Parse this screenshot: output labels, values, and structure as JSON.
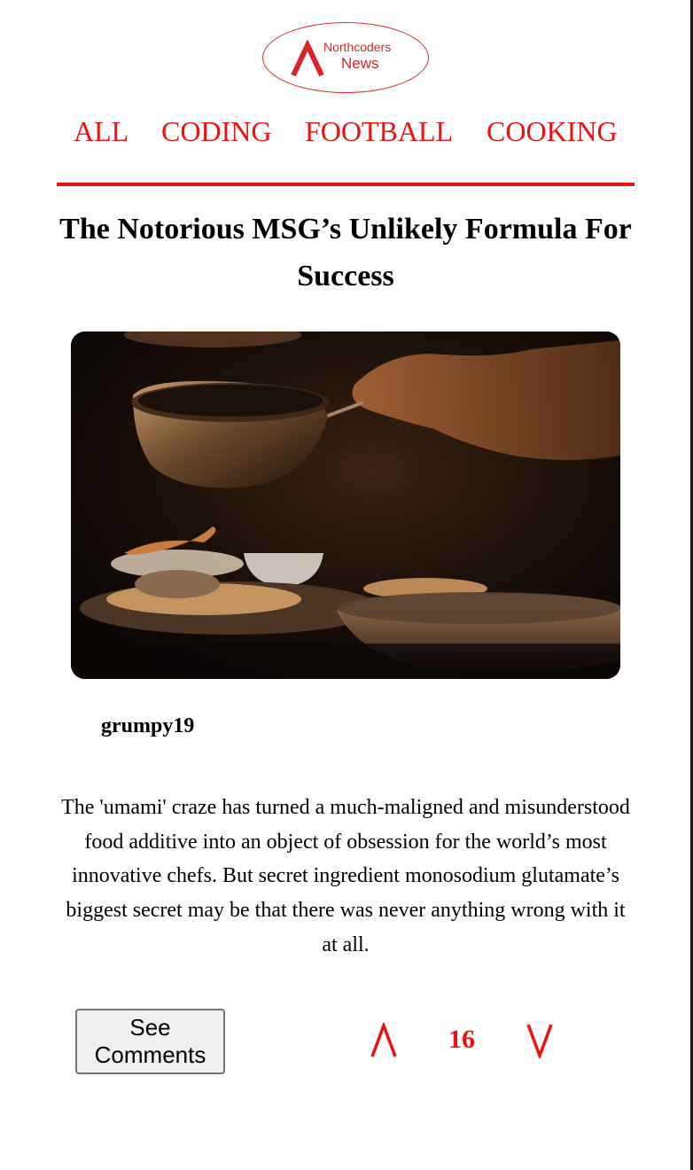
{
  "logo": {
    "line1": "Northcoders",
    "line2": "News",
    "icon": "northcoders-logo-icon"
  },
  "nav": {
    "items": [
      {
        "label": "ALL"
      },
      {
        "label": "CODING"
      },
      {
        "label": "FOOTBALL"
      },
      {
        "label": "COOKING"
      }
    ]
  },
  "article": {
    "title": "The Notorious MSG’s Unlikely Formula For Success",
    "author": "grumpy19",
    "body": "The 'umami' craze has turned a much-maligned and misunderstood food additive into an object of obsession for the world’s most innovative chefs. But secret ingredient monosodium glutamate’s biggest secret may be that there was never anything wrong with it at all.",
    "votes": "16",
    "image_alt": "Chef plating food in a dimly lit kitchen"
  },
  "actions": {
    "comments_label": "See Comments",
    "upvote_icon": "upvote-chevron-icon",
    "downvote_icon": "downvote-chevron-icon"
  },
  "colors": {
    "accent": "#ee1111",
    "logo_red": "#d8242b",
    "button_bg": "#efefef",
    "button_border": "#767676"
  }
}
